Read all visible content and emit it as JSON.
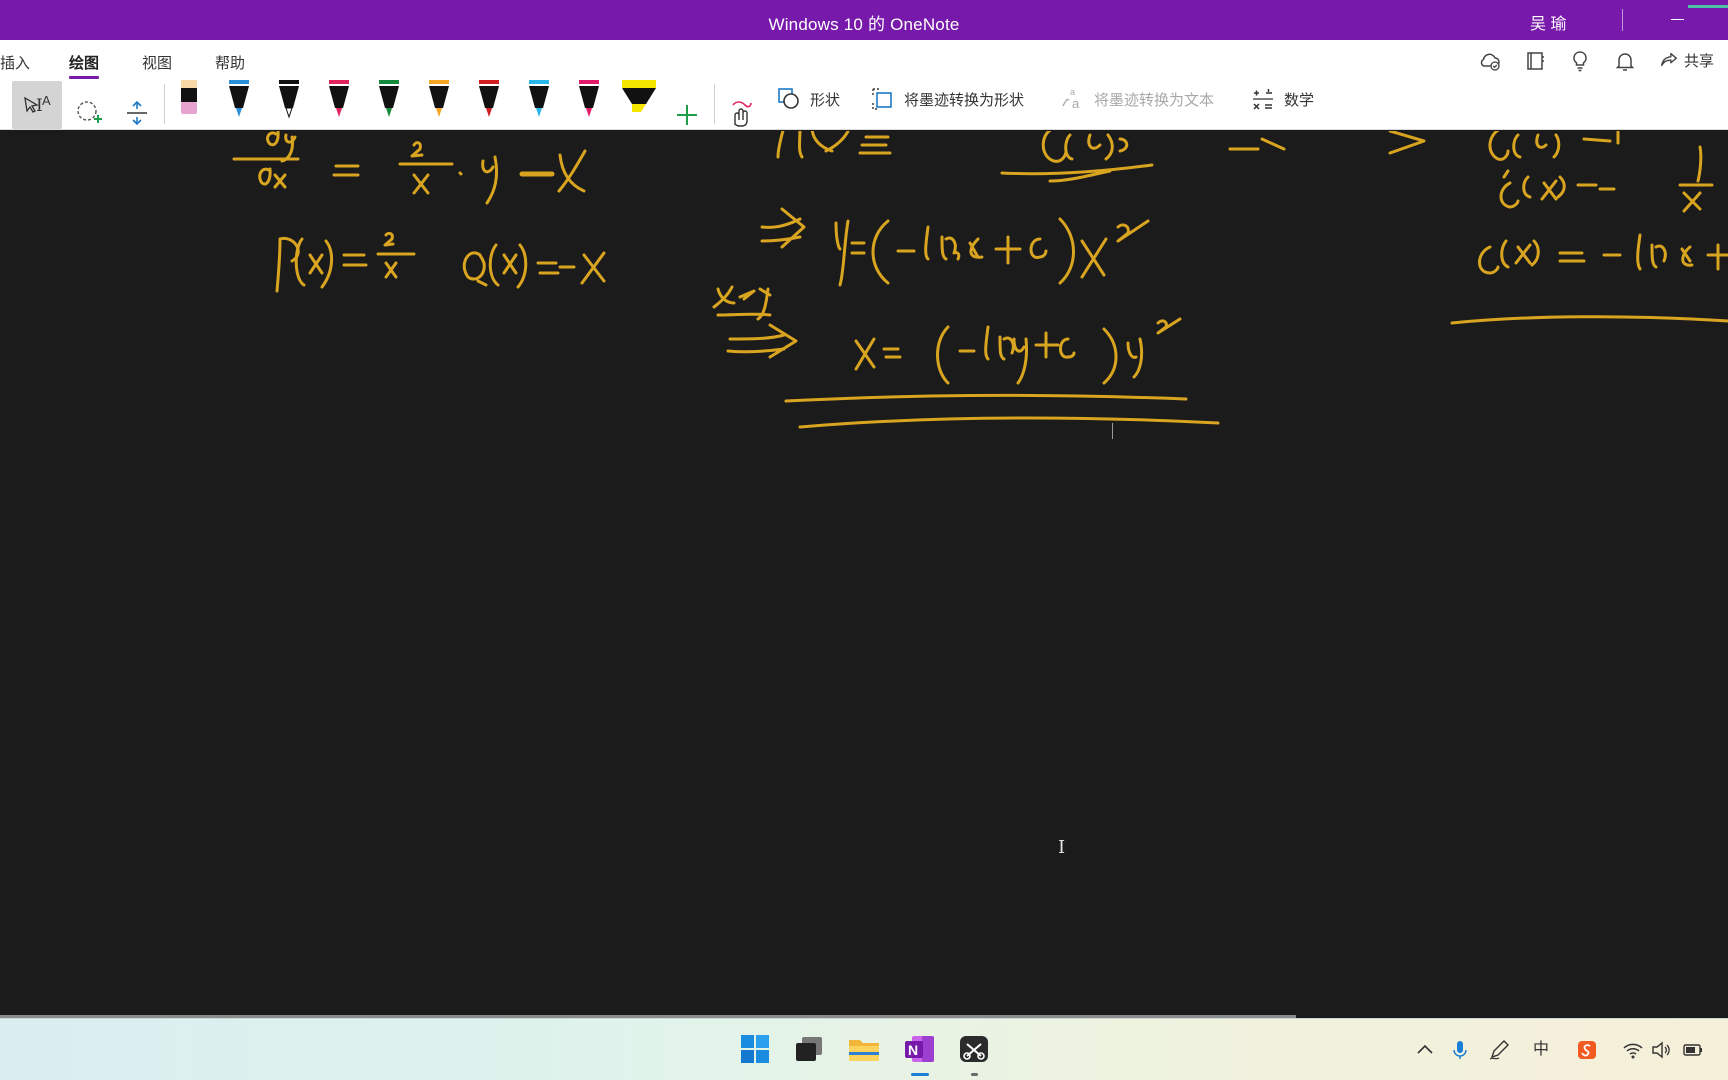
{
  "window": {
    "title": "Windows 10 的 OneNote",
    "user": "吴 瑜"
  },
  "ribbon": {
    "tabs": [
      {
        "label": "插入"
      },
      {
        "label": "绘图"
      },
      {
        "label": "视图"
      },
      {
        "label": "帮助"
      }
    ],
    "active_tab": "绘图",
    "share_label": "共享",
    "accent": "#7719aa"
  },
  "toolbar": {
    "shapes_label": "形状",
    "ink_to_shape_label": "将墨迹转换为形状",
    "ink_to_text_label": "将墨迹转换为文本",
    "math_label": "数学",
    "pens": [
      {
        "name": "highlighter-pink",
        "color": "#e6a3cf"
      },
      {
        "name": "pen-blue",
        "color": "#2a8fd8"
      },
      {
        "name": "pen-black",
        "color": "#111111"
      },
      {
        "name": "pen-red",
        "color": "#e0245e"
      },
      {
        "name": "pen-green",
        "color": "#138a3c"
      },
      {
        "name": "pen-orange",
        "color": "#f5a623"
      },
      {
        "name": "pen-darkred",
        "color": "#d11d1d"
      },
      {
        "name": "pen-cyan",
        "color": "#29b6e8"
      },
      {
        "name": "pen-magenta",
        "color": "#e3196a"
      },
      {
        "name": "highlighter-yellow",
        "color": "#f5e600"
      }
    ]
  },
  "ink": {
    "color": "#d9a520"
  },
  "taskbar": {
    "apps": [
      "start-icon",
      "task-view-icon",
      "file-explorer-icon",
      "onenote-icon",
      "snipping-tool-icon"
    ],
    "tray_ime": "中"
  }
}
